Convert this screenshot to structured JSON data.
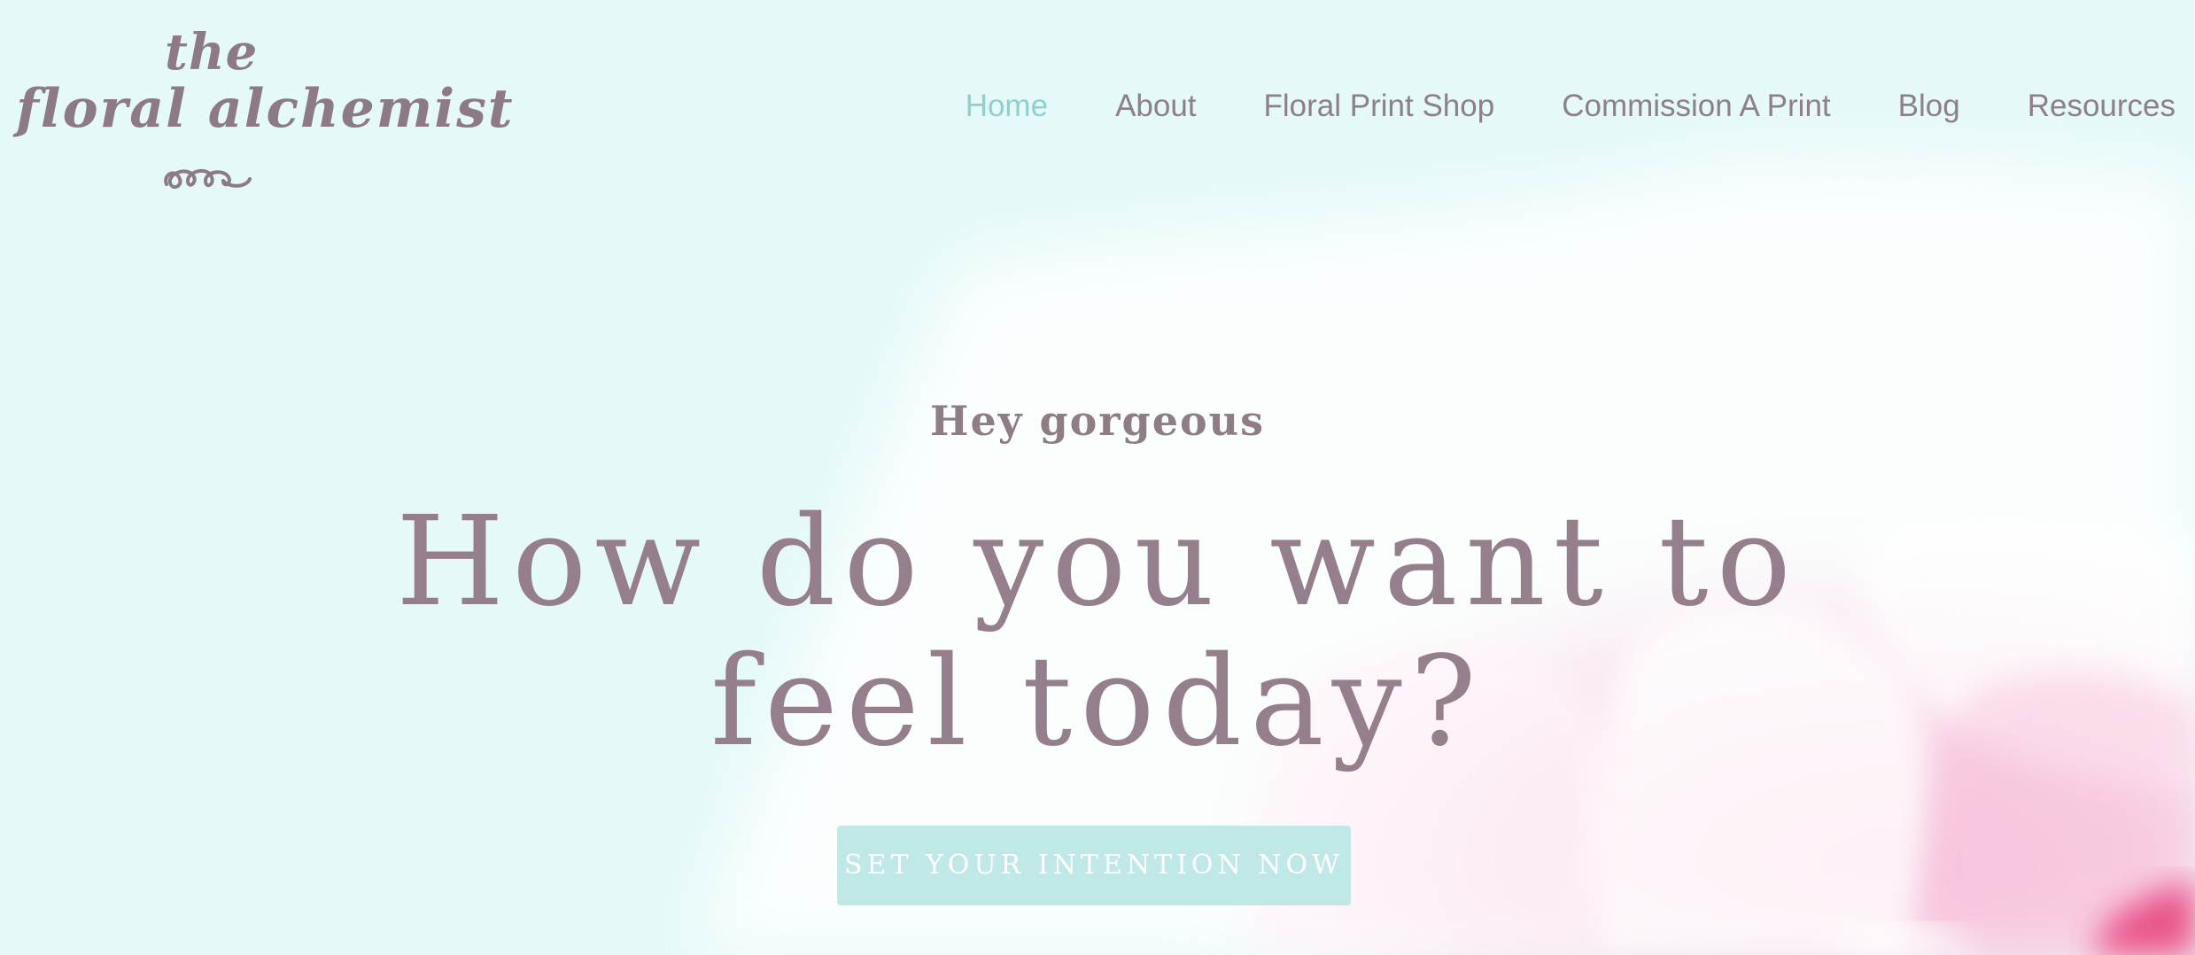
{
  "logo": {
    "line1": "the",
    "line2": "floral alchemist"
  },
  "nav": {
    "items": [
      {
        "label": "Home",
        "active": true
      },
      {
        "label": "About",
        "active": false
      },
      {
        "label": "Floral Print Shop",
        "active": false
      },
      {
        "label": "Commission A Print",
        "active": false
      },
      {
        "label": "Blog",
        "active": false
      },
      {
        "label": "Resources",
        "active": false
      }
    ]
  },
  "hero": {
    "greeting": "Hey gorgeous",
    "headline": "How do you want to feel today?",
    "cta_label": "SET YOUR INTENTION NOW"
  },
  "colors": {
    "background": "#e4f9f8",
    "accent": "#8fd0cf",
    "text": "#927f8b",
    "button": "#c0e8e6",
    "flower_pink": "#f5a3cc"
  }
}
